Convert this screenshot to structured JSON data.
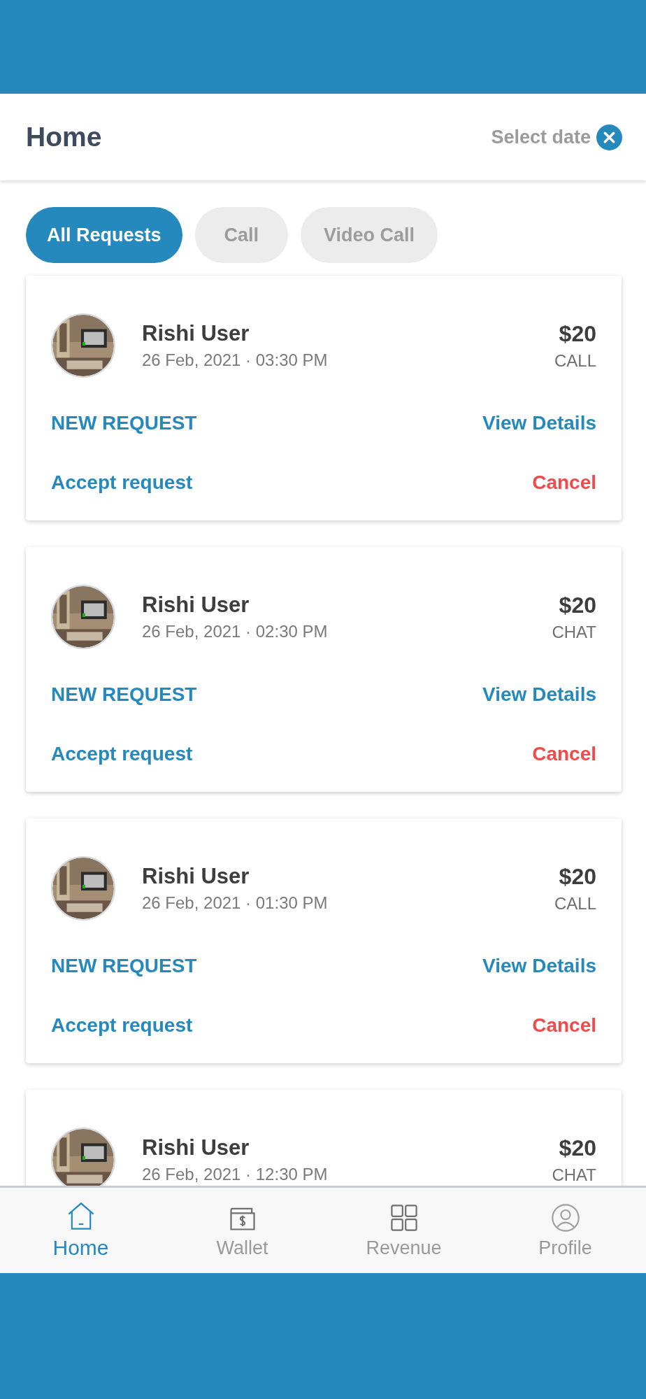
{
  "header": {
    "title": "Home",
    "date_filter": {
      "label": "Select date"
    }
  },
  "tabs": [
    {
      "label": "All Requests",
      "selected": true
    },
    {
      "label": "Call",
      "selected": false
    },
    {
      "label": "Video Call",
      "selected": false
    }
  ],
  "requests": [
    {
      "name": "Rishi User",
      "datetime": "26 Feb, 2021 · 03:30 PM",
      "price": "$20",
      "type": "CALL",
      "status": "NEW REQUEST",
      "details_link": "View Details",
      "accept": "Accept request",
      "cancel": "Cancel"
    },
    {
      "name": "Rishi User",
      "datetime": "26 Feb, 2021 · 02:30 PM",
      "price": "$20",
      "type": "CHAT",
      "status": "NEW REQUEST",
      "details_link": "View Details",
      "accept": "Accept request",
      "cancel": "Cancel"
    },
    {
      "name": "Rishi User",
      "datetime": "26 Feb, 2021 · 01:30 PM",
      "price": "$20",
      "type": "CALL",
      "status": "NEW REQUEST",
      "details_link": "View Details",
      "accept": "Accept request",
      "cancel": "Cancel"
    },
    {
      "name": "Rishi User",
      "datetime": "26 Feb, 2021 · 12:30 PM",
      "price": "$20",
      "type": "CHAT"
    }
  ],
  "bottom_nav": [
    {
      "label": "Home",
      "selected": true
    },
    {
      "label": "Wallet",
      "selected": false
    },
    {
      "label": "Revenue",
      "selected": false
    },
    {
      "label": "Profile",
      "selected": false
    }
  ]
}
